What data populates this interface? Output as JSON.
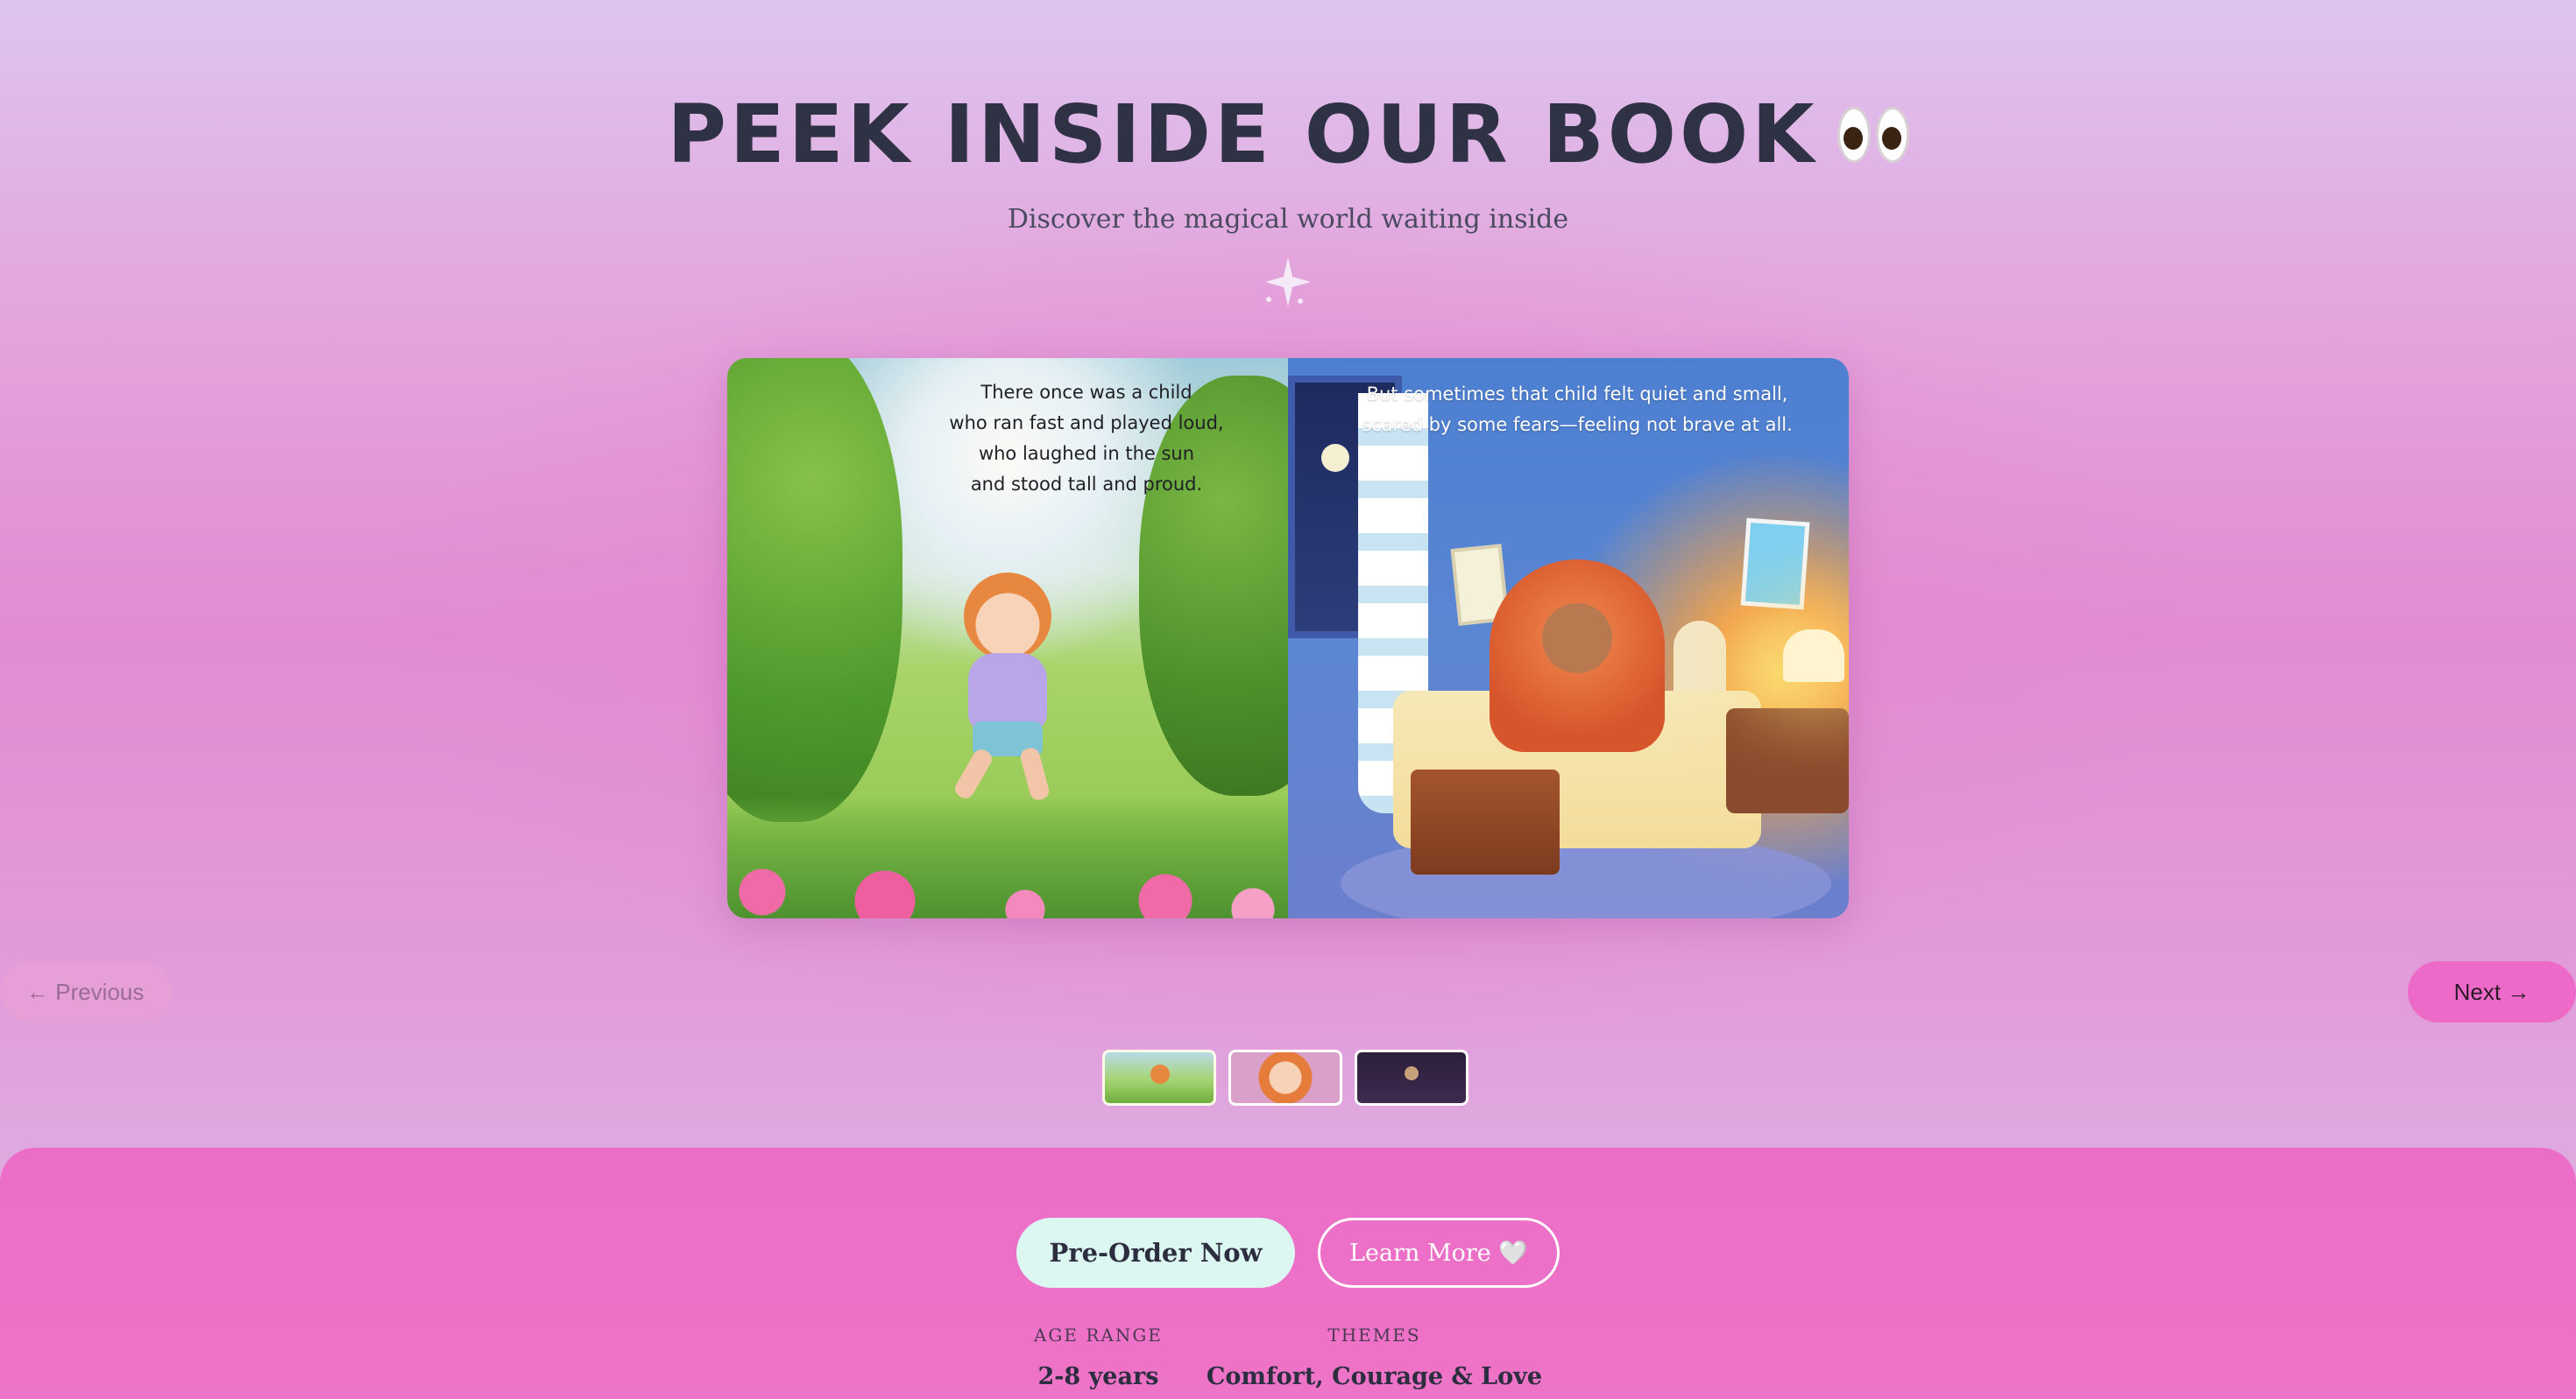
{
  "header": {
    "title": "PEEK INSIDE OUR BOOK",
    "title_icon": "eyes-icon",
    "subtitle": "Discover the magical world waiting inside",
    "divider_icon": "sparkle-icon"
  },
  "book": {
    "left_page": {
      "lines": [
        "There once was a child",
        "who ran fast and played loud,",
        "who laughed in the sun",
        "and stood tall and proud."
      ]
    },
    "right_page": {
      "lines": [
        "But sometimes that child felt quiet and small,",
        "scared by some fears—feeling not brave at all."
      ]
    }
  },
  "navigation": {
    "prev_label": "← Previous",
    "next_label": "Next →"
  },
  "thumbnails": [
    "page-spread-1",
    "page-spread-2",
    "page-spread-3"
  ],
  "cta": {
    "primary_label": "Pre-Order Now",
    "secondary_label": "Learn More 🤍",
    "stats": [
      {
        "label": "AGE RANGE",
        "value": "2-8 years"
      },
      {
        "label": "THEMES",
        "value": "Comfort, Courage & Love"
      }
    ]
  },
  "colors": {
    "accent_pink": "#ee6ac8",
    "cta_band": "#ec6dc8",
    "primary_button": "#dcf6f2",
    "title_text": "#2f3145"
  }
}
